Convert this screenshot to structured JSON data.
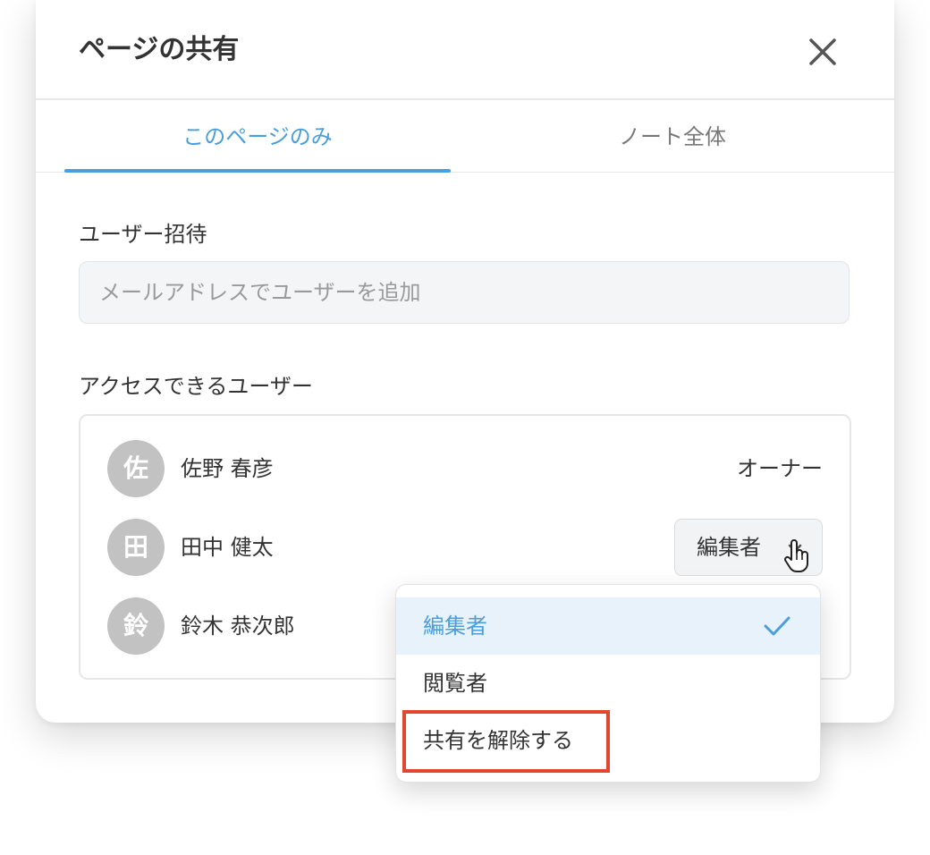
{
  "dialog": {
    "title": "ページの共有"
  },
  "tabs": [
    {
      "label": "このページのみ",
      "active": true
    },
    {
      "label": "ノート全体",
      "active": false
    }
  ],
  "invite": {
    "label": "ユーザー招待",
    "placeholder": "メールアドレスでユーザーを追加",
    "value": ""
  },
  "access": {
    "label": "アクセスできるユーザー",
    "users": [
      {
        "avatar": "佐",
        "name": "佐野 春彦",
        "role": "オーナー"
      },
      {
        "avatar": "田",
        "name": "田中 健太",
        "role": "編集者"
      },
      {
        "avatar": "鈴",
        "name": "鈴木 恭次郎",
        "role": ""
      }
    ]
  },
  "dropdown": {
    "items": [
      {
        "label": "編集者",
        "selected": true
      },
      {
        "label": "閲覧者",
        "selected": false
      },
      {
        "label": "共有を解除する",
        "selected": false
      }
    ]
  },
  "colors": {
    "accent": "#4a9ed9",
    "highlight": "#e2472d",
    "avatar": "#c2c2c2",
    "selected_bg": "#e8f2fb"
  },
  "icons": {
    "close": "close-icon",
    "dropdown": "chevron-down-icon",
    "check": "check-icon",
    "cursor": "hand-pointer-icon"
  }
}
